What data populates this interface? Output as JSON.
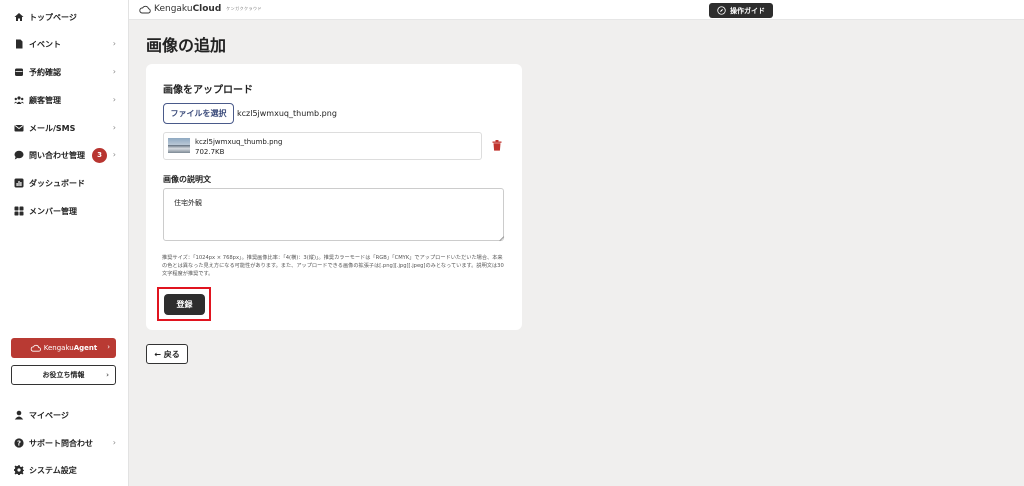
{
  "sidebar": {
    "items": [
      {
        "label": "トップページ",
        "icon": "home-icon",
        "chevron": ""
      },
      {
        "label": "イベント",
        "icon": "document-icon",
        "chevron": "›"
      },
      {
        "label": "予約確認",
        "icon": "calendar-icon",
        "chevron": "›"
      },
      {
        "label": "顧客管理",
        "icon": "people-icon",
        "chevron": "›"
      },
      {
        "label": "メール/SMS",
        "icon": "mail-icon",
        "chevron": "›"
      },
      {
        "label": "問い合わせ管理",
        "icon": "chat-icon",
        "chevron": "›",
        "badge": "3"
      },
      {
        "label": "ダッシュボード",
        "icon": "chart-icon",
        "chevron": ""
      },
      {
        "label": "メンバー管理",
        "icon": "grid-icon",
        "chevron": ""
      }
    ],
    "agent_button": {
      "prefix": "Kengaku",
      "bold": "Agent",
      "chevron": "›"
    },
    "useful_button": {
      "label": "お役立ち情報",
      "chevron": "›"
    },
    "bottom_items": [
      {
        "label": "マイページ",
        "icon": "user-icon",
        "chevron": ""
      },
      {
        "label": "サポート問合わせ",
        "icon": "help-icon",
        "chevron": "›"
      },
      {
        "label": "システム設定",
        "icon": "gear-icon",
        "chevron": ""
      }
    ]
  },
  "header": {
    "logo_prefix": "Kengaku",
    "logo_bold": "Cloud",
    "logo_sub": "ケンガククラウド",
    "guide_label": "操作ガイド"
  },
  "main": {
    "page_title": "画像の追加",
    "upload_title": "画像をアップロード",
    "file_button": "ファイルを選択",
    "file_name": "kczl5jwmxuq_thumb.png",
    "uploaded_file": {
      "name": "kczl5jwmxuq_thumb.png",
      "size": "702.7KB"
    },
    "description_title": "画像の説明文",
    "description_value": "住宅外観",
    "note": "推奨サイズ：「1024px × 768px」。推奨画像比率：「4(横)：3(縦)」。推奨カラーモードは「RGB」「CMYK」でアップロードいただいた場合、本来の色とは異なった見え方になる可能性があります。また、アップロードできる画像の拡張子は[.png][.jpg][.jpeg]のみとなっています。説明文は30文字程度が推奨です。",
    "submit_label": "登録",
    "back_label": "← 戻る"
  },
  "colors": {
    "accent_red": "#b93a33",
    "highlight_red": "#e0141f",
    "dark_button": "#2e2e2e"
  }
}
